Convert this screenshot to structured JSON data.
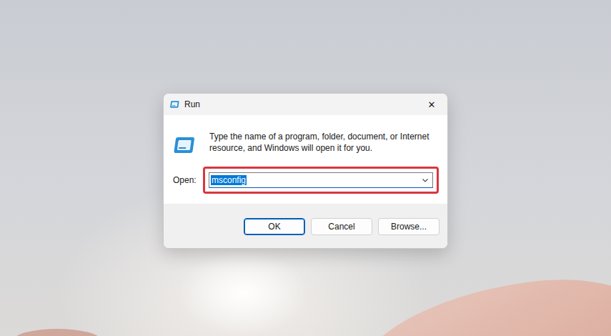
{
  "window": {
    "title": "Run",
    "close": "✕"
  },
  "description": "Type the name of a program, folder, document, or Internet resource, and Windows will open it for you.",
  "field": {
    "label": "Open:",
    "value": "msconfig",
    "text_selected": true,
    "highlighted": true
  },
  "buttons": [
    {
      "label": "OK",
      "focused": true
    },
    {
      "label": "Cancel",
      "focused": false
    },
    {
      "label": "Browse...",
      "focused": false
    }
  ]
}
